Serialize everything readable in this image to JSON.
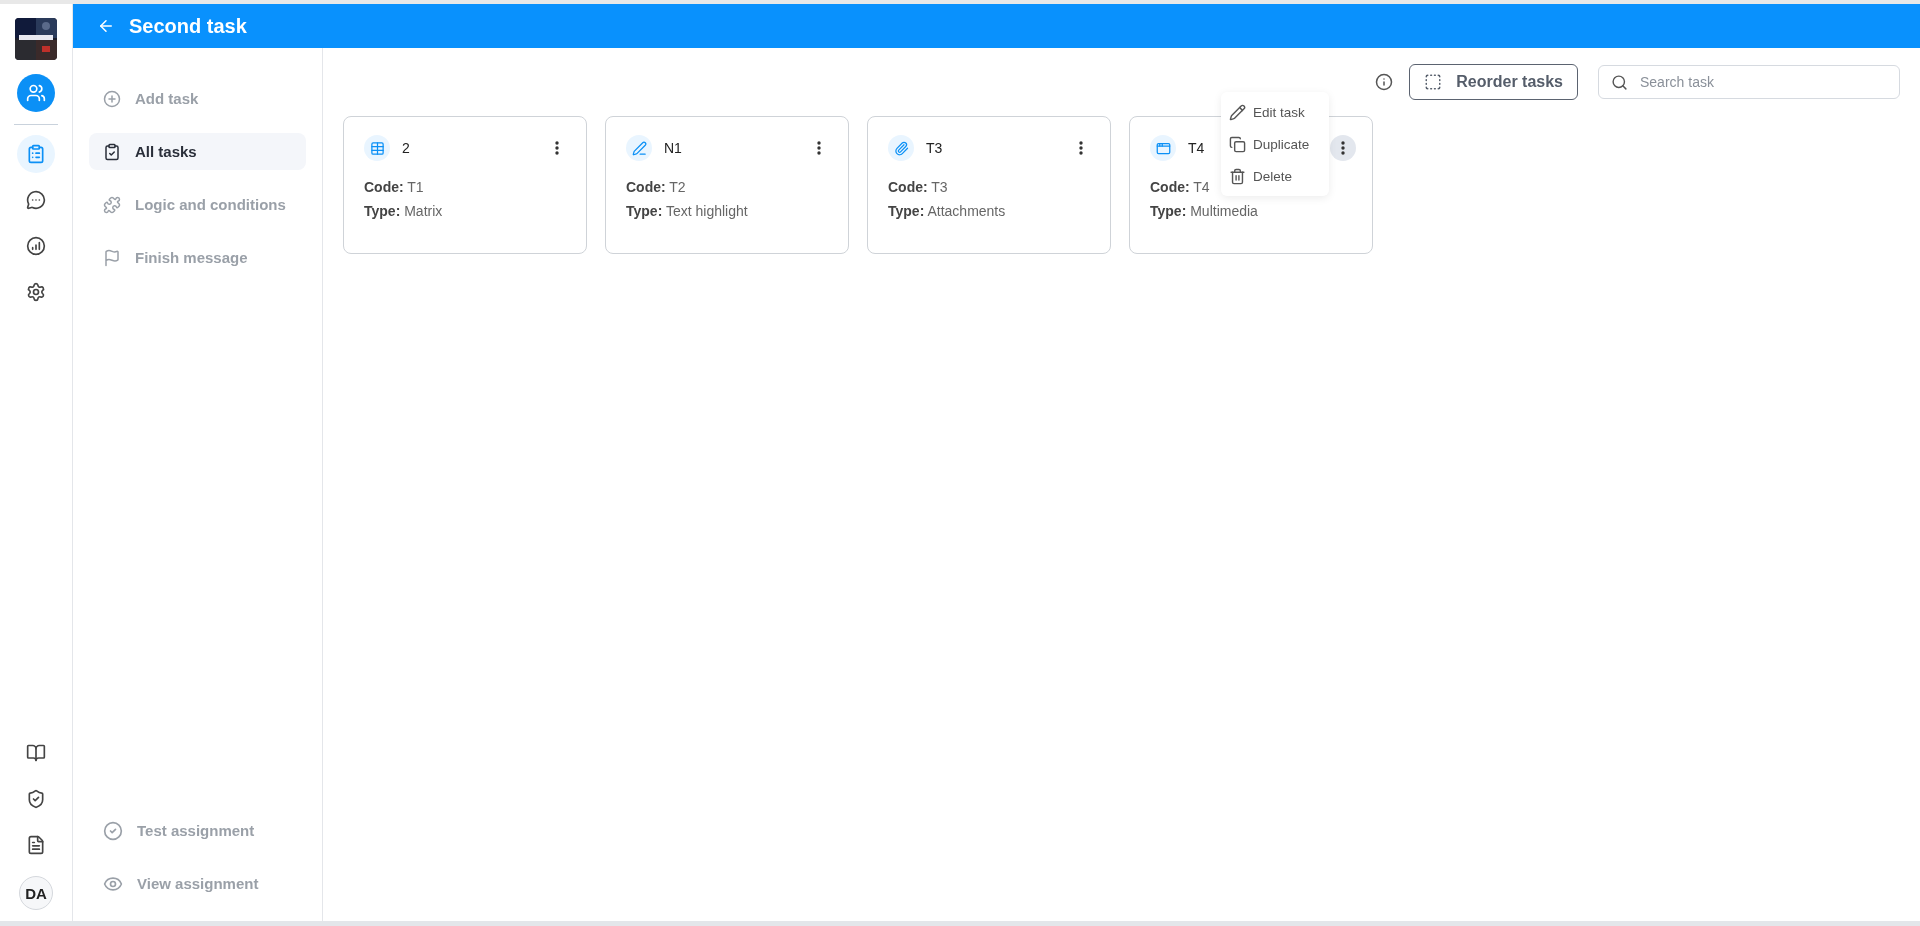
{
  "header": {
    "title": "Second task"
  },
  "rail": {
    "items": [
      {
        "kind": "users",
        "selected": true
      },
      {
        "kind": "tasks",
        "selected": true
      },
      {
        "kind": "chat",
        "selected": false
      },
      {
        "kind": "stats",
        "selected": false
      },
      {
        "kind": "settings",
        "selected": false
      }
    ],
    "bottom": [
      {
        "kind": "book"
      },
      {
        "kind": "shield"
      },
      {
        "kind": "document"
      }
    ],
    "avatar": "DA"
  },
  "sidebar": {
    "items": [
      {
        "kind": "add",
        "label": "Add task",
        "selected": false
      },
      {
        "kind": "tasks",
        "label": "All tasks",
        "selected": true
      },
      {
        "kind": "logic",
        "label": "Logic and conditions",
        "selected": false
      },
      {
        "kind": "finish",
        "label": "Finish message",
        "selected": false
      }
    ],
    "bottom": [
      {
        "kind": "test",
        "label": "Test assignment"
      },
      {
        "kind": "view",
        "label": "View assignment"
      }
    ]
  },
  "toolbar": {
    "reorder": "Reorder tasks",
    "search": {
      "placeholder": "Search task"
    }
  },
  "cards": [
    {
      "kind": "matrix",
      "title": "2",
      "code_label": "Code:",
      "code": "T1",
      "type_label": "Type:",
      "type": "Matrix",
      "menu_open": false
    },
    {
      "kind": "highlight",
      "title": "N1",
      "code_label": "Code:",
      "code": "T2",
      "type_label": "Type:",
      "type": "Text highlight",
      "menu_open": false
    },
    {
      "kind": "attachment",
      "title": "T3",
      "code_label": "Code:",
      "code": "T3",
      "type_label": "Type:",
      "type": "Attachments",
      "menu_open": false
    },
    {
      "kind": "media",
      "title": "T4",
      "code_label": "Code:",
      "code": "T4",
      "type_label": "Type:",
      "type": "Multimedia",
      "menu_open": true
    }
  ],
  "card_menu": [
    {
      "kind": "edit",
      "label": "Edit task"
    },
    {
      "kind": "duplicate",
      "label": "Duplicate"
    },
    {
      "kind": "delete",
      "label": "Delete"
    }
  ]
}
